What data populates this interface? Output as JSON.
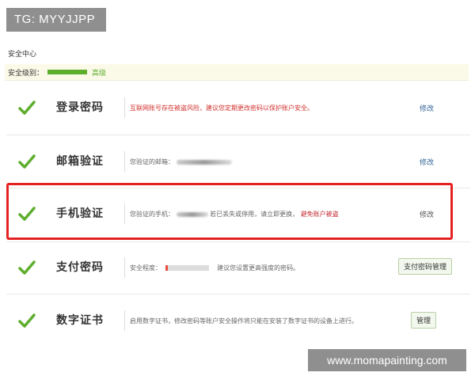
{
  "badge": "TG: MYYJJPP",
  "page_title": "安全中心",
  "security_level": {
    "label": "安全级别：",
    "value": "高级",
    "meter_fraction": 1.0
  },
  "items": [
    {
      "title": "登录密码",
      "desc": "互联网账号存在被盗风险，建议您定期更改密码以保护账户安全。",
      "action": "修改"
    },
    {
      "title": "邮箱验证",
      "desc_prefix": "您验证的邮箱：",
      "action": "修改"
    },
    {
      "title": "手机验证",
      "desc_prefix": "您验证的手机：",
      "desc_mid": "若已丢失或停用，请立即更换，",
      "desc_red": "避免账户被盗",
      "action": "修改"
    },
    {
      "title": "支付密码",
      "desc_prefix": "安全程度：",
      "desc_suffix": "建议您设置更高强度的密码。",
      "action": "支付密码管理"
    },
    {
      "title": "数字证书",
      "desc": "启用数字证书，修改密码等账户安全操作将只能在安装了数字证书的设备上进行。",
      "action": "管理"
    }
  ],
  "watermark": "www.momapainting.com",
  "colors": {
    "accent_green": "#5eae2e",
    "highlight_red": "#e52222",
    "link_blue": "#336699"
  }
}
